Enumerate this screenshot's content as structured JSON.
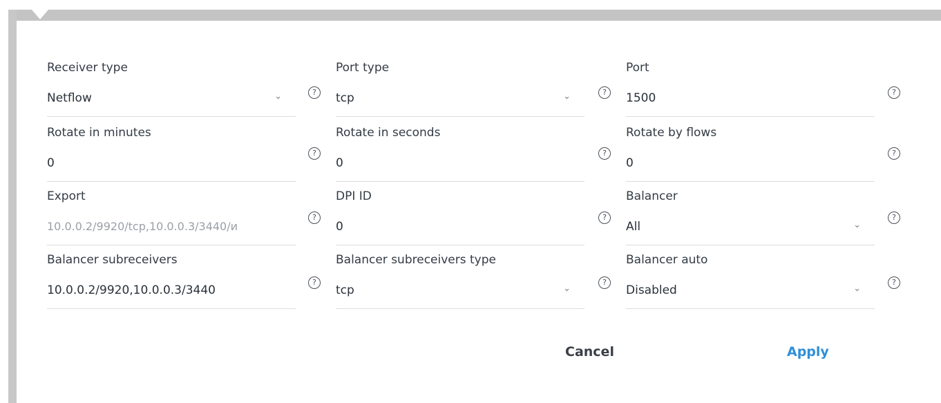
{
  "fields": [
    {
      "label": "Receiver type",
      "value": "Netflow",
      "type": "select"
    },
    {
      "label": "Port type",
      "value": "tcp",
      "type": "select"
    },
    {
      "label": "Port",
      "value": "1500",
      "type": "input"
    },
    {
      "label": "Rotate in minutes",
      "value": "0",
      "type": "input"
    },
    {
      "label": "Rotate in seconds",
      "value": "0",
      "type": "input"
    },
    {
      "label": "Rotate by flows",
      "value": "0",
      "type": "input"
    },
    {
      "label": "Export",
      "value": "10.0.0.2/9920/tcp,10.0.0.3/3440/и",
      "type": "input"
    },
    {
      "label": "DPI ID",
      "value": "0",
      "type": "input"
    },
    {
      "label": "Balancer",
      "value": "All",
      "type": "select"
    },
    {
      "label": "Balancer subreceivers",
      "value": "10.0.0.2/9920,10.0.0.3/3440",
      "type": "input"
    },
    {
      "label": "Balancer subreceivers type",
      "value": "tcp",
      "type": "select"
    },
    {
      "label": "Balancer auto",
      "value": "Disabled",
      "type": "select"
    }
  ],
  "help_icon": "question-circle-icon",
  "chevron_icon": "chevron-down-icon",
  "buttons": {
    "cancel_label": "Cancel",
    "apply_label": "Apply"
  },
  "colors": {
    "accent": "#2f8fd8",
    "label": "#333b45",
    "muted_value": "#9aa0a7"
  }
}
